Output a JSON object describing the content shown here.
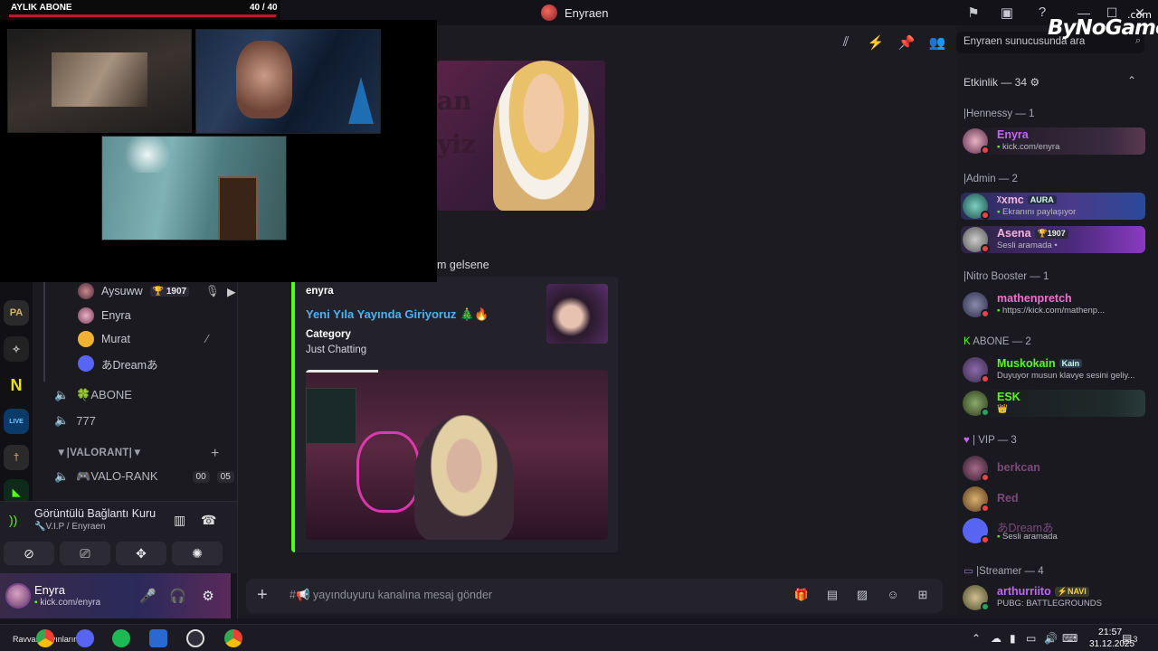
{
  "window": {
    "title": "Enyraen",
    "controls": [
      "—",
      "☐",
      "✕"
    ]
  },
  "overlay": {
    "sub_label": "AYLIK ABONE",
    "sub_count": "40 / 40"
  },
  "watermark": {
    "text": "ByNoGame",
    "suffix": ".com"
  },
  "voice_channel": {
    "users": [
      {
        "name": "Aysuww",
        "badge": "🏆 1907",
        "color": "#c9cbd1"
      },
      {
        "name": "Enyra",
        "badge": "",
        "color": "#c9cbd1"
      },
      {
        "name": "Murat",
        "badge": "",
        "color": "#c9cbd1"
      },
      {
        "name": "あDreamあ",
        "badge": "",
        "color": "#c9cbd1"
      }
    ]
  },
  "channels": [
    {
      "name": "🍀ABONE"
    },
    {
      "name": "777"
    }
  ],
  "category": {
    "name": "▼|VALORANT|▼"
  },
  "valo_channel": {
    "name": "🎮VALO-RANK",
    "left": "00",
    "right": "05"
  },
  "voice_status": {
    "title": "Görüntülü Bağlantı Kuru",
    "sub": "🔧V.I.P / Enyraen"
  },
  "user_panel": {
    "name": "Enyra",
    "status": "kick.com/enyra"
  },
  "chat": {
    "partial_message": "m gelsene",
    "image_words": [
      "an",
      "yiz"
    ],
    "embed": {
      "author": "enyra",
      "title": "Yeni Yıla Yayında Giriyoruz 🎄🔥",
      "field_name": "Category",
      "field_value": "Just Chatting"
    },
    "composer_prefix": "#📢",
    "composer_placeholder": "yayınduyuru kanalına mesaj gönder"
  },
  "members": {
    "search_placeholder": "Enyraen sunucusunda ara",
    "header": "Etkinlik — 34 ⚙",
    "groups": [
      {
        "title": "|Hennessy — 1",
        "members": [
          {
            "name": "Enyra",
            "status": "kick.com/enyra",
            "color": "#c266f5"
          }
        ]
      },
      {
        "title": "|Admin — 2",
        "members": [
          {
            "name": "ᵡxmc",
            "tag": "AURA",
            "status": "Ekranını paylaşıyor",
            "color": "#f2b6d9"
          },
          {
            "name": "Asena",
            "tag": "🏆1907",
            "status": "Sesli aramada •",
            "color": "#f2b6d9"
          }
        ]
      },
      {
        "title": "|Nitro Booster — 1",
        "members": [
          {
            "name": "mathenpretch",
            "status": "https://kick.com/mathenp...",
            "color": "#f26fd1"
          }
        ]
      },
      {
        "title": "ABONE — 2",
        "members": [
          {
            "name": "Muskokain",
            "tag": "Kain",
            "status": "Duyuyor musun klavye sesini geliy...",
            "color": "#53fc18"
          },
          {
            "name": "ESK",
            "tag": "",
            "status": "👑",
            "color": "#53fc18"
          }
        ]
      },
      {
        "title": "| VIP — 3",
        "members": [
          {
            "name": "berkcan",
            "status": "",
            "color": "#7a4a7a"
          },
          {
            "name": "Red",
            "status": "",
            "color": "#7a4a7a"
          },
          {
            "name": "あDreamあ",
            "status": "Sesli aramada",
            "color": "#7a4a7a"
          }
        ]
      },
      {
        "title": "|Streamer — 4",
        "members": [
          {
            "name": "arthurriito",
            "tag": "⚡NAVI",
            "status": "PUBG: BATTLEGROUNDS",
            "color": "#c266f5"
          }
        ]
      }
    ]
  },
  "taskbar": {
    "left_text": "Ravvas Yayınlarımım",
    "time": "21:57",
    "date": "31.12.2025",
    "notif_count": "3"
  },
  "colors": {
    "accent_green": "#53fc18",
    "embed_title": "#4ab3f4",
    "sub_line": "#c0182a"
  }
}
